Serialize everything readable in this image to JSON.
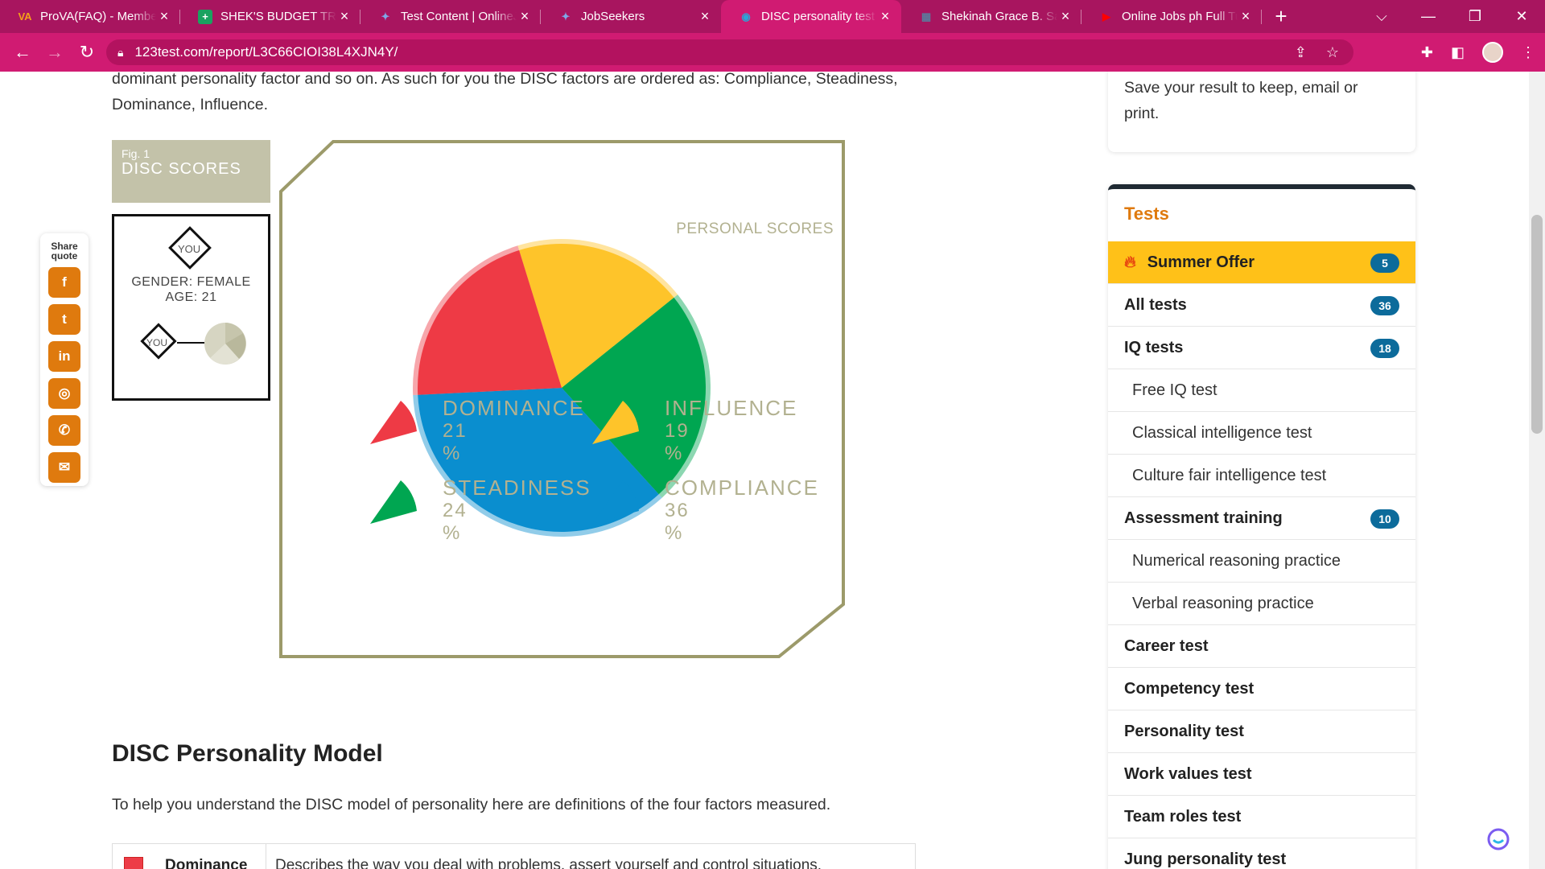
{
  "browser": {
    "tabs": [
      {
        "title": "ProVA(FAQ) - Member",
        "icon": "VA",
        "color": "#f4a01a"
      },
      {
        "title": "SHEK'S BUDGET TRAC",
        "icon": "+",
        "color": "#1aa260"
      },
      {
        "title": "Test Content | OnlineJ",
        "icon": "✦",
        "color": "#7fa8e8"
      },
      {
        "title": "JobSeekers",
        "icon": "✦",
        "color": "#7fa8e8"
      },
      {
        "title": "DISC personality test r",
        "icon": "◉",
        "color": "#29a6d8"
      },
      {
        "title": "Shekinah Grace B. Sar",
        "icon": "▦",
        "color": "#5b7a9c"
      },
      {
        "title": "Online Jobs ph Full Tu",
        "icon": "▶",
        "color": "#ff0000"
      }
    ],
    "url": "123test.com/report/L3C66CIOI38L4XJN4Y/"
  },
  "report": {
    "intro_line1": "dominant personality factor and so on. As such for you the DISC factors are ordered as: Compliance, Steadiness,",
    "intro_line2": "Dominance, Influence.",
    "fig_number": "Fig. 1",
    "fig_title": "DISC SCORES",
    "you_label": "YOU",
    "gender": "GENDER: FEMALE",
    "age": "AGE: 21",
    "chart_heading": "PERSONAL SCORES"
  },
  "chart_data": {
    "type": "pie",
    "title": "PERSONAL SCORES",
    "series": [
      {
        "name": "DOMINANCE",
        "label": "21 %",
        "value": 21,
        "color": "#ee3a45"
      },
      {
        "name": "INFLUENCE",
        "label": "19 %",
        "value": 19,
        "color": "#fec42a"
      },
      {
        "name": "STEADINESS",
        "label": "24 %",
        "value": 24,
        "color": "#00a651"
      },
      {
        "name": "COMPLIANCE",
        "label": "36 %",
        "value": 36,
        "color": "#0a8ecf"
      }
    ]
  },
  "share": {
    "title_line1": "Share",
    "title_line2": "quote",
    "buttons": [
      {
        "name": "facebook",
        "glyph": "f"
      },
      {
        "name": "twitter",
        "glyph": "t"
      },
      {
        "name": "linkedin",
        "glyph": "in"
      },
      {
        "name": "instagram",
        "glyph": "◎"
      },
      {
        "name": "messenger",
        "glyph": "✆"
      },
      {
        "name": "email",
        "glyph": "✉"
      }
    ]
  },
  "model": {
    "heading": "DISC Personality Model",
    "paragraph": "To help you understand the DISC model of personality here are definitions of the four factors measured.",
    "first_row_name": "Dominance",
    "first_row_desc": "Describes the way you deal with problems, assert yourself and control situations."
  },
  "sidebar": {
    "save_text_line1": "Save your result to keep, email or",
    "save_text_line2": "print.",
    "tests_heading": "Tests",
    "items": [
      {
        "label": "Summer Offer",
        "badge": "5",
        "kind": "offer"
      },
      {
        "label": "All tests",
        "badge": "36",
        "kind": "bold"
      },
      {
        "label": "IQ tests",
        "badge": "18",
        "kind": "bold"
      },
      {
        "label": "Free IQ test",
        "badge": "",
        "kind": "sub"
      },
      {
        "label": "Classical intelligence test",
        "badge": "",
        "kind": "sub"
      },
      {
        "label": "Culture fair intelligence test",
        "badge": "",
        "kind": "sub"
      },
      {
        "label": "Assessment training",
        "badge": "10",
        "kind": "bold"
      },
      {
        "label": "Numerical reasoning practice",
        "badge": "",
        "kind": "sub"
      },
      {
        "label": "Verbal reasoning practice",
        "badge": "",
        "kind": "sub"
      },
      {
        "label": "Career test",
        "badge": "",
        "kind": "bold"
      },
      {
        "label": "Competency test",
        "badge": "",
        "kind": "bold"
      },
      {
        "label": "Personality test",
        "badge": "",
        "kind": "bold"
      },
      {
        "label": "Work values test",
        "badge": "",
        "kind": "bold"
      },
      {
        "label": "Team roles test",
        "badge": "",
        "kind": "bold"
      },
      {
        "label": "Jung personality test",
        "badge": "",
        "kind": "bold"
      }
    ]
  }
}
